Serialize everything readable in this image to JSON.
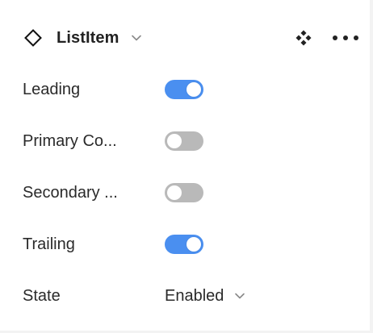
{
  "header": {
    "title": "ListItem",
    "icons": {
      "component": "component-diamond-icon",
      "title_chevron": "chevron-down-icon",
      "instance": "instance-icon",
      "more": "more-icon"
    }
  },
  "properties": [
    {
      "label": "Leading",
      "type": "toggle",
      "value": true
    },
    {
      "label": "Primary Co...",
      "type": "toggle",
      "value": false
    },
    {
      "label": "Secondary ...",
      "type": "toggle",
      "value": false
    },
    {
      "label": "Trailing",
      "type": "toggle",
      "value": true
    },
    {
      "label": "State",
      "type": "select",
      "value": "Enabled"
    }
  ],
  "colors": {
    "toggle_on": "#4a8ff0",
    "toggle_off": "#b9b9b9",
    "text": "#2a2a2a"
  }
}
